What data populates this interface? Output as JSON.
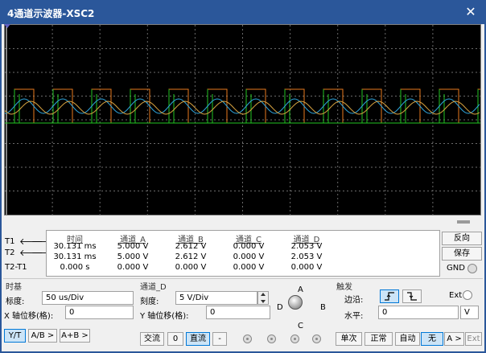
{
  "window": {
    "title": "4通道示波器-XSC2",
    "close": "✕"
  },
  "colors": {
    "titlebar": "#2b579a",
    "ch_a": "#e87a1e",
    "ch_b": "#2ea7e0",
    "ch_c": "#22c422",
    "grid": "#6a6a6a"
  },
  "readout": {
    "headers": [
      "时间",
      "通道_A",
      "通道_B",
      "通道_C",
      "通道_D"
    ],
    "rows": [
      {
        "label": "T1",
        "values": [
          "30.131 ms",
          "5.000 V",
          "2.612 V",
          "0.000 V",
          "2.053 V"
        ]
      },
      {
        "label": "T2",
        "values": [
          "30.131 ms",
          "5.000 V",
          "2.612 V",
          "0.000 V",
          "2.053 V"
        ]
      },
      {
        "label": "T2-T1",
        "values": [
          "0.000 s",
          "0.000 V",
          "0.000 V",
          "0.000 V",
          "0.000 V"
        ]
      }
    ]
  },
  "right_buttons": {
    "reverse": "反向",
    "save": "保存",
    "gnd": "GND"
  },
  "timebase": {
    "title": "时基",
    "scale_label": "标度:",
    "scale_value": "50 us/Div",
    "xpos_label": "X 轴位移(格):",
    "xpos_value": "0",
    "modes": [
      "Y/T",
      "A/B >",
      "A+B >"
    ]
  },
  "channel": {
    "title": "通道_D",
    "scale_label": "刻度:",
    "scale_value": "5  V/Div",
    "ypos_label": "Y 轴位移(格):",
    "ypos_value": "0",
    "coupling": [
      "交流",
      "0",
      "直流",
      "-"
    ],
    "selector": {
      "A": "A",
      "B": "B",
      "C": "C",
      "D": "D"
    }
  },
  "trigger": {
    "title": "触发",
    "edge_label": "边沿:",
    "ext_label": "Ext",
    "level_label": "水平:",
    "level_value": "0",
    "level_unit": "V",
    "modes": [
      "单次",
      "正常",
      "自动",
      "无",
      "A >",
      "Ext"
    ]
  }
}
